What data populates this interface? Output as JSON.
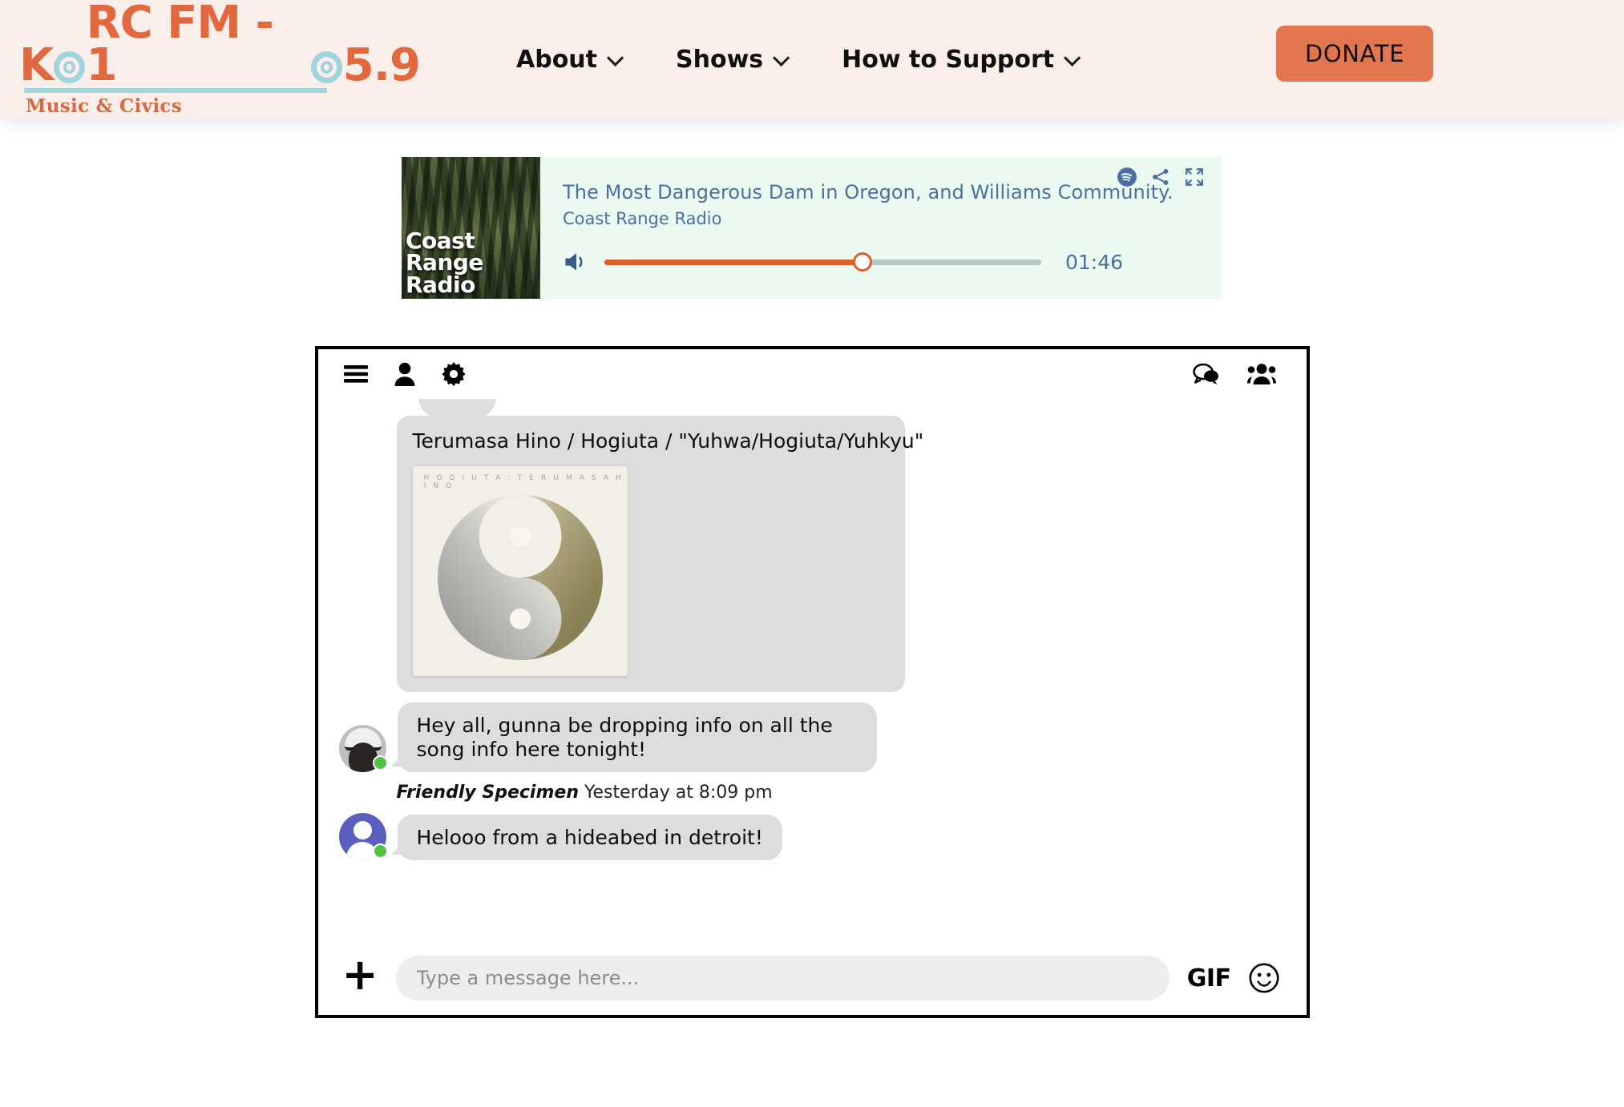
{
  "header": {
    "brand": {
      "wordmark_prefix": "K",
      "wordmark_mid": "RC FM - 1",
      "wordmark_suffix": "5.9",
      "tagline": "Music & Civics",
      "accent_color": "#e1683f",
      "ring_color": "#9fd4dd",
      "background": "#faeeea"
    },
    "nav": [
      {
        "label": "About",
        "has_dropdown": true
      },
      {
        "label": "Shows",
        "has_dropdown": true
      },
      {
        "label": "How to Support",
        "has_dropdown": true
      }
    ],
    "donate_label": "DONATE",
    "donate_color": "#e2764e"
  },
  "player": {
    "artwork_text": "Coast\nRange\nRadio",
    "artwork_line1": "Coast",
    "artwork_line2": "Range",
    "artwork_line3": "Radio",
    "episode_title": "The Most Dangerous Dam in Oregon, and Williams Community...",
    "show_name": "Coast Range Radio",
    "time_display": "01:46",
    "progress_percent": 59,
    "background": "#eafaf1",
    "text_color": "#4b6fa5",
    "accent_color": "#dd5f2d",
    "icons": {
      "spotify": "spotify-icon",
      "share": "share-icon",
      "expand": "expand-icon",
      "volume": "volume-icon"
    }
  },
  "chat": {
    "toolbar": {
      "left_icons": [
        "menu-icon",
        "user-icon",
        "gear-icon"
      ],
      "right_icons": [
        "chat-bubbles-icon",
        "users-group-icon"
      ]
    },
    "messages": [
      {
        "type": "song",
        "title": "Terumasa Hino / Hogiuta / \"Yuhwa/Hogiuta/Yuhkyu\"",
        "album_caption": "H O G I U T A : T E R U M A S A   H I N O"
      },
      {
        "type": "text",
        "avatar": "photo-avatar",
        "online": true,
        "text": "Hey all, gunna be dropping info on all the song info here tonight!"
      },
      {
        "type": "text",
        "avatar": "default-avatar",
        "online": true,
        "author": "Friendly Specimen",
        "timestamp": "Yesterday at 8:09 pm",
        "text": "Helooo from a hideabed in detroit!"
      }
    ],
    "input": {
      "placeholder": "Type a message here...",
      "value": "",
      "plus_label": "+",
      "gif_label": "GIF",
      "emoji_icon": "smiley-icon"
    }
  }
}
